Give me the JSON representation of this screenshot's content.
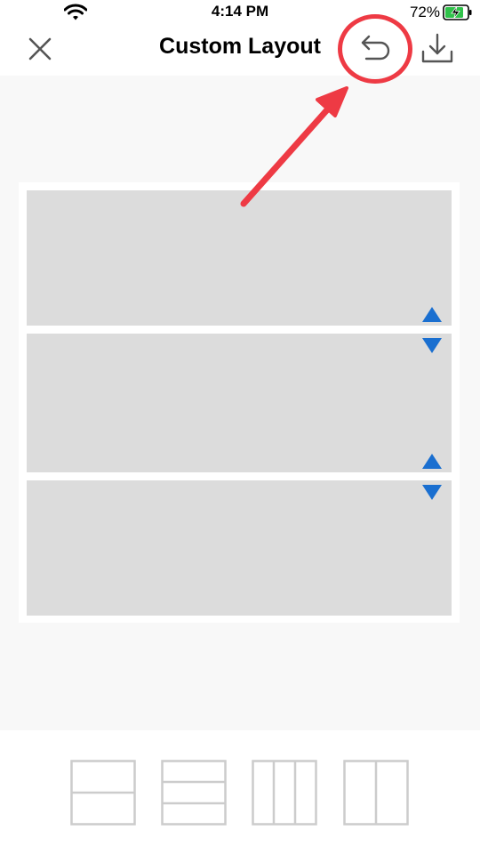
{
  "status_bar": {
    "time": "4:14 PM",
    "battery_percent": "72%",
    "wifi_icon": "wifi-icon",
    "battery_icon": "battery-charging-icon"
  },
  "nav": {
    "title": "Custom Layout",
    "close_icon": "close-icon",
    "undo_icon": "undo-icon",
    "download_icon": "download-icon"
  },
  "layout": {
    "panels": 3,
    "accent_color": "#1a6fd0",
    "panel_color": "#dcdcdc"
  },
  "annotation": {
    "color": "#ee3a44",
    "target": "undo-button"
  },
  "picker": {
    "options": [
      "two-row-layout",
      "three-row-layout",
      "three-column-layout",
      "two-column-layout"
    ],
    "stroke_color": "#cccccc"
  }
}
